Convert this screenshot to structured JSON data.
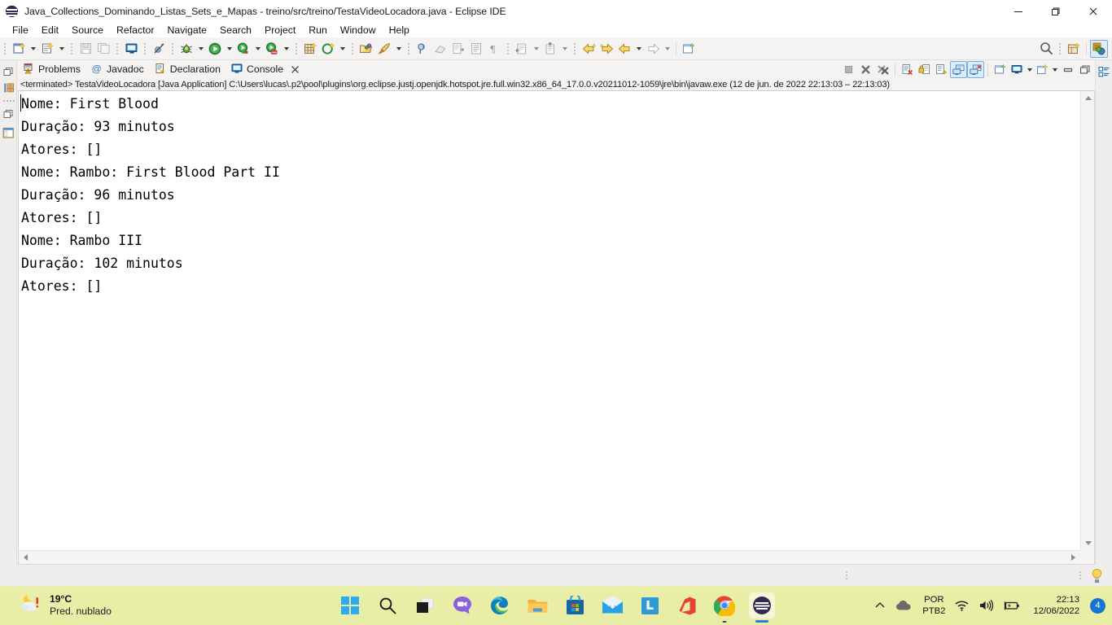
{
  "window": {
    "title": "Java_Collections_Dominando_Listas_Sets_e_Mapas - treino/src/treino/TestaVideoLocadora.java - Eclipse IDE",
    "controls": {
      "minimize": "—",
      "maximize": "❐",
      "close": "✕"
    }
  },
  "menubar": {
    "items": [
      "File",
      "Edit",
      "Source",
      "Refactor",
      "Navigate",
      "Search",
      "Project",
      "Run",
      "Window",
      "Help"
    ]
  },
  "toolbar": {
    "groups": [
      {
        "buttons": [
          {
            "name": "new-wizard-icon",
            "dropdown": true
          },
          {
            "name": "new-java-class-icon",
            "dropdown": true
          }
        ]
      },
      {
        "buttons": [
          {
            "name": "save-icon",
            "dropdown": false
          },
          {
            "name": "save-all-icon",
            "dropdown": false
          }
        ]
      },
      {
        "buttons": [
          {
            "name": "console-view-icon",
            "dropdown": false
          }
        ]
      },
      {
        "buttons": [
          {
            "name": "skip-breakpoints-icon",
            "dropdown": false
          }
        ]
      },
      {
        "buttons": [
          {
            "name": "debug-icon",
            "dropdown": true
          },
          {
            "name": "run-icon",
            "dropdown": true
          },
          {
            "name": "run-configurations-icon",
            "dropdown": true
          },
          {
            "name": "coverage-icon",
            "dropdown": true
          }
        ]
      },
      {
        "buttons": [
          {
            "name": "new-java-project-icon",
            "dropdown": false
          },
          {
            "name": "new-package-icon",
            "dropdown": true
          }
        ]
      },
      {
        "buttons": [
          {
            "name": "open-type-icon",
            "dropdown": false
          },
          {
            "name": "open-task-icon",
            "dropdown": true
          }
        ]
      },
      {
        "buttons": [
          {
            "name": "toggle-mark-occurrences-icon",
            "dropdown": false
          },
          {
            "name": "eraser-icon",
            "dropdown": false
          },
          {
            "name": "next-annotation-icon",
            "dropdown": false
          },
          {
            "name": "previous-annotation-icon",
            "dropdown": false
          },
          {
            "name": "pilcrow-icon",
            "dropdown": false
          }
        ]
      },
      {
        "buttons": [
          {
            "name": "last-edit-location-icon",
            "dropdown": true
          },
          {
            "name": "previous-edit-icon",
            "dropdown": true
          }
        ]
      },
      {
        "buttons": [
          {
            "name": "back-to-icon",
            "dropdown": false
          },
          {
            "name": "forward-to-icon",
            "dropdown": false
          },
          {
            "name": "back-icon",
            "dropdown": true
          },
          {
            "name": "forward-icon",
            "dropdown": true
          }
        ]
      },
      {
        "buttons": [
          {
            "name": "new-window-icon",
            "dropdown": false
          }
        ]
      }
    ],
    "right": [
      {
        "name": "search-icon"
      },
      {
        "name": "open-perspective-icon"
      },
      {
        "name": "java-perspective-icon",
        "active": true
      }
    ]
  },
  "left_rail": {
    "icons": [
      "restore-view-icon",
      "package-explorer-icon",
      "minimized-view-icon",
      "outline-view-icon"
    ]
  },
  "right_rail": {
    "icons": [
      "outline-tree-icon"
    ]
  },
  "view": {
    "tabs": [
      {
        "label": "Problems",
        "icon": "problems-icon",
        "selected": false,
        "closable": false
      },
      {
        "label": "Javadoc",
        "icon": "javadoc-at-icon",
        "selected": false,
        "closable": false
      },
      {
        "label": "Declaration",
        "icon": "declaration-icon",
        "selected": false,
        "closable": false
      },
      {
        "label": "Console",
        "icon": "console-icon",
        "selected": true,
        "closable": true
      }
    ],
    "toolbar_icons": [
      {
        "name": "terminate-icon",
        "enabled": false
      },
      {
        "name": "remove-launch-icon",
        "enabled": true
      },
      {
        "name": "remove-all-terminated-icon",
        "enabled": true
      },
      {
        "name": "clear-console-icon",
        "enabled": true
      },
      {
        "name": "scroll-lock-icon",
        "enabled": true
      },
      {
        "name": "word-wrap-icon",
        "enabled": true
      },
      {
        "name": "show-console-on-output-icon",
        "enabled": true,
        "framed": true
      },
      {
        "name": "show-console-on-error-icon",
        "enabled": true,
        "framed": true
      },
      {
        "name": "pin-console-icon",
        "enabled": true
      },
      {
        "name": "display-selected-console-icon",
        "enabled": true,
        "dropdown": true
      },
      {
        "name": "open-console-icon",
        "enabled": true,
        "dropdown": true
      },
      {
        "name": "minimize-view-icon",
        "enabled": true
      },
      {
        "name": "maximize-view-icon",
        "enabled": true
      }
    ],
    "status_line": "<terminated> TestaVideoLocadora [Java Application] C:\\Users\\lucas\\.p2\\pool\\plugins\\org.eclipse.justj.openjdk.hotspot.jre.full.win32.x86_64_17.0.0.v20211012-1059\\jre\\bin\\javaw.exe  (12 de jun. de 2022 22:13:03 – 22:13:03)",
    "console_output": "Nome: First Blood\nDuração: 93 minutos\nAtores: []\nNome: Rambo: First Blood Part II\nDuração: 96 minutos\nAtores: []\nNome: Rambo III\nDuração: 102 minutos\nAtores: []"
  },
  "status_bar": {
    "quick_access_icon": "tip-lightbulb-icon"
  },
  "taskbar": {
    "weather": {
      "temperature": "19°C",
      "description": "Pred. nublado",
      "icon": "partly-cloudy-night-icon"
    },
    "apps": [
      {
        "name": "start-button",
        "icon": "windows-logo-icon"
      },
      {
        "name": "search-taskbar-button",
        "icon": "search-icon"
      },
      {
        "name": "task-view-button",
        "icon": "task-view-icon"
      },
      {
        "name": "chat-button",
        "icon": "chat-icon"
      },
      {
        "name": "edge-button",
        "icon": "edge-icon"
      },
      {
        "name": "file-explorer-button",
        "icon": "folder-icon"
      },
      {
        "name": "microsoft-store-button",
        "icon": "store-icon"
      },
      {
        "name": "mail-button",
        "icon": "mail-icon"
      },
      {
        "name": "linkedin-button",
        "icon": "linkedin-icon"
      },
      {
        "name": "office-button",
        "icon": "office-icon"
      },
      {
        "name": "chrome-button",
        "icon": "chrome-icon",
        "running": true
      },
      {
        "name": "eclipse-button",
        "icon": "eclipse-icon",
        "active": true
      }
    ],
    "tray": {
      "overflow_icon": "chevron-up-icon",
      "cloud_icon": "onedrive-icon",
      "language": {
        "line1": "POR",
        "line2": "PTB2"
      },
      "wifi_icon": "wifi-icon",
      "volume_icon": "speaker-icon",
      "battery_icon": "battery-charging-icon",
      "time": "22:13",
      "date": "12/06/2022",
      "notification_count": "4"
    }
  },
  "colors": {
    "accent_blue": "#1675d1",
    "taskbar_bg": "#e8eea6",
    "toolbar_bg": "#f4f3f2",
    "console_bg": "#ffffff"
  }
}
